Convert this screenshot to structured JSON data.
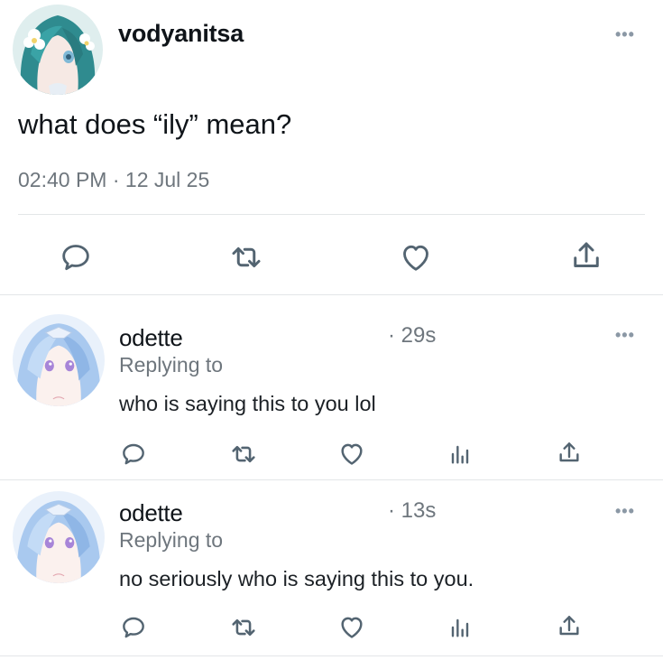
{
  "main_tweet": {
    "username": "vodyanitsa",
    "text": "what does “ily” mean?",
    "time": "02:40 PM",
    "separator": "·",
    "date": "12 Jul 25",
    "more": "•••"
  },
  "actions": {
    "reply_icon": "speech-bubble",
    "retweet_icon": "retweet-arrows",
    "like_icon": "heart",
    "share_icon": "share-upload",
    "views_icon": "bar-chart"
  },
  "replies": [
    {
      "username": "odette",
      "time": "· 29s",
      "replying_to": "Replying to",
      "text": "who is saying this to you lol",
      "more": "•••"
    },
    {
      "username": "odette",
      "time": "· 13s",
      "replying_to": "Replying to",
      "text": "no seriously who is saying this to you.",
      "more": "•••"
    }
  ],
  "colors": {
    "text": "#0f1419",
    "muted": "#6e767d",
    "icon": "#536471",
    "divider": "#e3e6e8"
  }
}
